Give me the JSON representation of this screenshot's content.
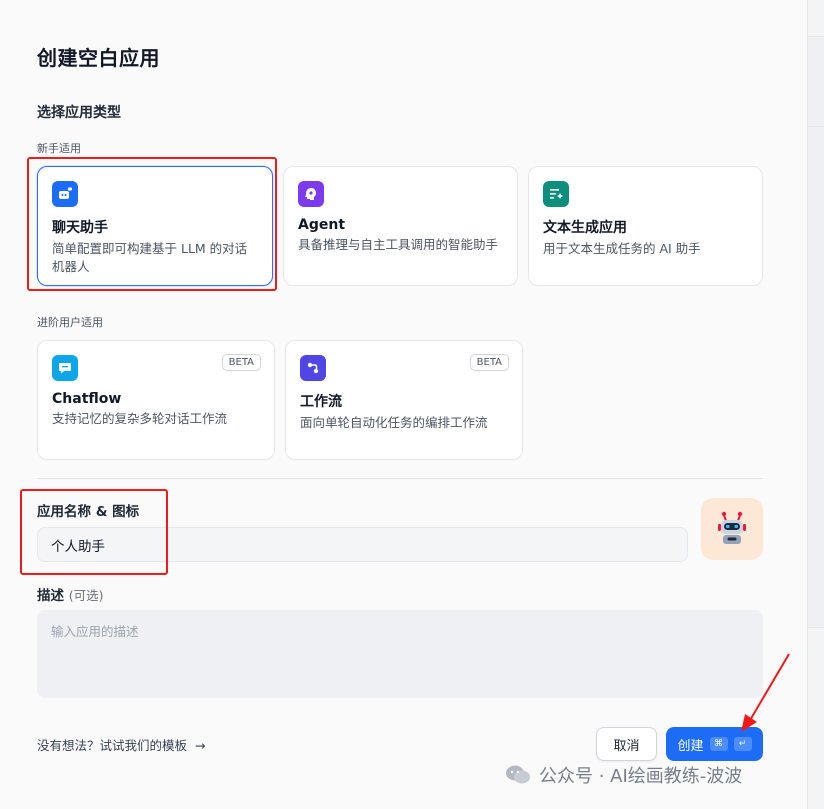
{
  "dialog": {
    "title": "创建空白应用",
    "section_type_label": "选择应用类型",
    "beginner_label": "新手适用",
    "advanced_label": "进阶用户适用"
  },
  "app_types": {
    "beginner": [
      {
        "title": "聊天助手",
        "desc": "简单配置即可构建基于 LLM 的对话机器人",
        "icon": "chat-bot-icon",
        "color": "#1d6cf5",
        "selected": true
      },
      {
        "title": "Agent",
        "desc": "具备推理与自主工具调用的智能助手",
        "icon": "agent-icon",
        "color": "#7c3aed",
        "selected": false
      },
      {
        "title": "文本生成应用",
        "desc": "用于文本生成任务的 AI 助手",
        "icon": "text-generator-icon",
        "color": "#0e8f7e",
        "selected": false
      }
    ],
    "advanced": [
      {
        "title": "Chatflow",
        "desc": "支持记忆的复杂多轮对话工作流",
        "icon": "chatflow-icon",
        "color": "#0ea5e9",
        "badge": "BETA"
      },
      {
        "title": "工作流",
        "desc": "面向单轮自动化任务的编排工作流",
        "icon": "workflow-icon",
        "color": "#4f46e5",
        "badge": "BETA"
      }
    ]
  },
  "form": {
    "name_icon_label": "应用名称 & 图标",
    "name_value": "个人助手",
    "avatar_icon": "robot-icon",
    "desc_label": "描述",
    "desc_optional": "(可选)",
    "desc_placeholder": "输入应用的描述"
  },
  "footer": {
    "template_link": "没有想法？试试我们的模板",
    "template_arrow": "→",
    "cancel": "取消",
    "create": "创建",
    "shortcut_cmd": "⌘",
    "shortcut_enter": "↵"
  },
  "watermark": "公众号 · AI绘画教练-波波",
  "colors": {
    "accent": "#1d6cf5",
    "annotation_red": "#ef1b1b"
  }
}
